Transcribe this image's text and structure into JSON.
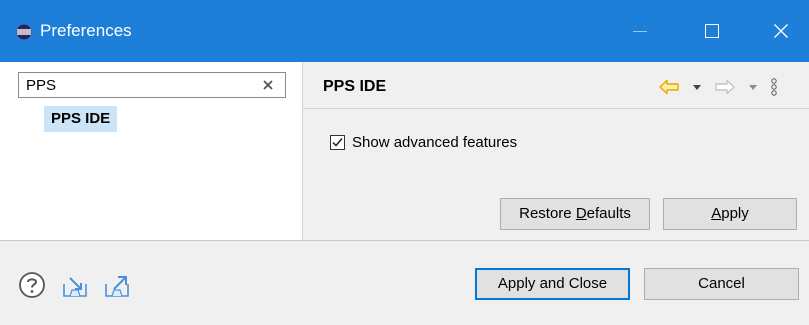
{
  "window": {
    "title": "Preferences",
    "title_icon": "eclipse-icon",
    "controls": [
      "minimize-icon",
      "maximize-icon",
      "close-icon"
    ]
  },
  "colors": {
    "titlebar": "#1e7fd9",
    "selection": "#cce4f7",
    "default_button_border": "#0078d7",
    "nav_arrow_active": "#e5a800"
  },
  "filter": {
    "value": "PPS",
    "clear_icon": "clear-icon"
  },
  "tree": {
    "items": [
      {
        "label": "PPS IDE",
        "selected": true
      }
    ]
  },
  "page": {
    "title": "PPS IDE",
    "nav_icons": [
      "back-arrow-icon",
      "dropdown-arrow-icon",
      "forward-arrow-icon",
      "dropdown-arrow-icon",
      "view-menu-icon"
    ],
    "checkbox": {
      "label": "Show advanced features",
      "checked": true
    },
    "buttons": {
      "restore_pre": "Restore ",
      "restore_mnemonic": "D",
      "restore_post": "efaults",
      "apply_mnemonic": "A",
      "apply_post": "pply"
    }
  },
  "footer": {
    "icons": [
      "help-icon",
      "import-icon",
      "export-icon"
    ],
    "apply_close_label": "Apply and Close",
    "cancel_label": "Cancel"
  }
}
